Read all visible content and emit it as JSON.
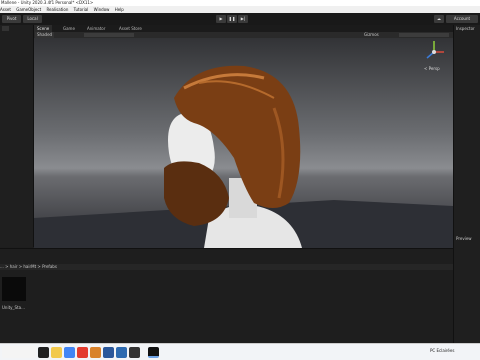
{
  "window": {
    "title": "Mallene - Unity 2020.3.4f1 Personal* <DX11>"
  },
  "menu": [
    "Asset",
    "GameObject",
    "Realisation",
    "Tutorial",
    "Window",
    "Help"
  ],
  "toolbar": {
    "pivot_label": "Pivot",
    "local_label": "Local",
    "play_icon": "play-icon",
    "pause_icon": "pause-icon",
    "step_icon": "step-icon",
    "account_label": "Account"
  },
  "tabs": [
    {
      "label": "Scene",
      "active": true
    },
    {
      "label": "Game",
      "active": false
    },
    {
      "label": "Animator",
      "active": false
    },
    {
      "label": "Asset Store",
      "active": false
    }
  ],
  "scene": {
    "shading_mode": "Shaded",
    "gizmos_label": "Gizmos",
    "persp_label": "< Persp"
  },
  "right_panel": {
    "inspector_label": "Inspector",
    "preview_label": "Preview"
  },
  "project": {
    "breadcrumb": [
      "...",
      "hair",
      "hairMt",
      "Prefabs"
    ],
    "asset_name": "Unity_Sta..."
  },
  "taskbar": {
    "system_label": "PC Eclairées"
  },
  "colors": {
    "editor_bg": "#1e1e1e",
    "hair": "#7a3e14",
    "beard": "#5a2e10",
    "skin": "#e6e6e6",
    "gizmo_x": "#d84b3b",
    "gizmo_y": "#8fcf3b",
    "gizmo_z": "#3b7bd8"
  }
}
